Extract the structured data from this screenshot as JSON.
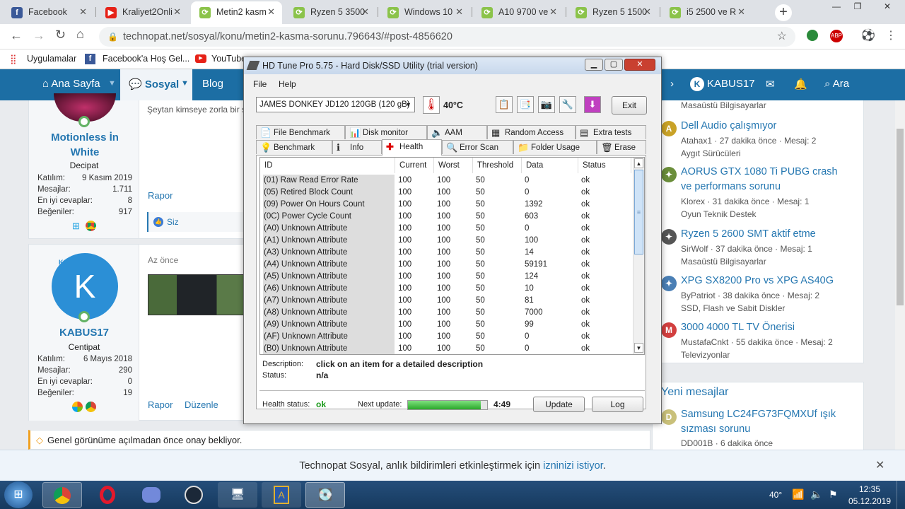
{
  "browser": {
    "tabs": [
      {
        "label": "Facebook",
        "color": "#3b5998",
        "glyph": "f"
      },
      {
        "label": "Kraliyet2Onli",
        "color": "#e62117",
        "glyph": "▶"
      },
      {
        "label": "Metin2 kasm",
        "color": "#8bc34a",
        "glyph": "⟳"
      },
      {
        "label": "Ryzen 5 3500",
        "color": "#8bc34a",
        "glyph": "⟳"
      },
      {
        "label": "Windows 10",
        "color": "#8bc34a",
        "glyph": "⟳"
      },
      {
        "label": "A10 9700 ve",
        "color": "#8bc34a",
        "glyph": "⟳"
      },
      {
        "label": "Ryzen 5 1500",
        "color": "#8bc34a",
        "glyph": "⟳"
      },
      {
        "label": "i5 2500 ve R",
        "color": "#8bc34a",
        "glyph": "⟳"
      }
    ],
    "url": "technopat.net/sosyal/konu/metin2-kasma-sorunu.796643/#post-4856620",
    "bookmarks": [
      "Uygulamalar",
      "Facebook'a Hoş Gel...",
      "YouTube"
    ]
  },
  "nav": {
    "home": "Ana Sayfa",
    "social": "Sosyal",
    "blog": "Blog",
    "user": "KABUS17",
    "search": "Ara"
  },
  "post1": {
    "username": "Motionless İn White",
    "rank": "Decipat",
    "text": "Şeytan kimseye zorla bir ş",
    "report": "Rapor",
    "like": "Siz",
    "stats": [
      {
        "label": "Katılım:",
        "value": "9 Kasım 2019"
      },
      {
        "label": "Mesajlar:",
        "value": "1.711"
      },
      {
        "label": "En iyi cevaplar:",
        "value": "8"
      },
      {
        "label": "Beğeniler:",
        "value": "917"
      }
    ]
  },
  "post2": {
    "avatar_letter": "K",
    "badge": "KS",
    "username": "KABUS17",
    "rank": "Centipat",
    "time": "Az önce",
    "report": "Rapor",
    "edit": "Düzenle",
    "stats": [
      {
        "label": "Katılım:",
        "value": "6 Mayıs 2018"
      },
      {
        "label": "Mesajlar:",
        "value": "290"
      },
      {
        "label": "En iyi cevaplar:",
        "value": "0"
      },
      {
        "label": "Beğeniler:",
        "value": "19"
      }
    ]
  },
  "pending": "Genel görünüme açılmadan önce onay bekliyor.",
  "sidebar": {
    "top_meta": "Masaüstü Bilgisayarlar",
    "items": [
      {
        "avatar": "A",
        "color": "#c9a227",
        "title": "Dell Audio çalışmıyor",
        "meta": "Atahax1 · 27 dakika önce · Mesaj: 2",
        "forum": "Aygıt Sürücüleri"
      },
      {
        "avatar": "✦",
        "color": "#6b8e3a",
        "title": "AORUS GTX 1080 Ti PUBG crash ve performans sorunu",
        "meta": "Klorex · 31 dakika önce · Mesaj: 1",
        "forum": "Oyun Teknik Destek"
      },
      {
        "avatar": "✦",
        "color": "#555555",
        "title": "Ryzen 5 2600 SMT aktif etme",
        "meta": "SirWolf · 37 dakika önce · Mesaj: 1",
        "forum": "Masaüstü Bilgisayarlar"
      },
      {
        "avatar": "✦",
        "color": "#4a7fb5",
        "title": "XPG SX8200 Pro vs XPG AS40G",
        "meta": "ByPatriot · 38 dakika önce · Mesaj: 2",
        "forum": "SSD, Flash ve Sabit Diskler"
      },
      {
        "avatar": "M",
        "color": "#d23f3f",
        "title": "3000 4000 TL TV Önerisi",
        "meta": "MustafaCnkt · 55 dakika önce · Mesaj: 2",
        "forum": "Televizyonlar"
      }
    ],
    "new_heading": "Yeni mesajlar",
    "new_item": {
      "avatar": "D",
      "color": "#c9c07a",
      "title": "Samsung LC24FG73FQMXUf ışık sızması sorunu",
      "meta": "DD001B · 6 dakika önce"
    }
  },
  "notification": {
    "text": "Technopat Sosyal, anlık bildirimleri etkinleştirmek için ",
    "link": "izninizi istiyor",
    "end": "."
  },
  "hdtune": {
    "title": "HD Tune Pro 5.75 - Hard Disk/SSD Utility (trial version)",
    "menu": [
      "File",
      "Help"
    ],
    "drive": "JAMES DONKEY JD120 120GB (120 gB)",
    "temp": "40°C",
    "exit": "Exit",
    "tabs_row1": [
      "File Benchmark",
      "Disk monitor",
      "AAM",
      "Random Access",
      "Extra tests"
    ],
    "tabs_row2": [
      "Benchmark",
      "Info",
      "Health",
      "Error Scan",
      "Folder Usage",
      "Erase"
    ],
    "columns": [
      "ID",
      "Current",
      "Worst",
      "Threshold",
      "Data",
      "Status"
    ],
    "rows": [
      [
        "(01) Raw Read Error Rate",
        "100",
        "100",
        "50",
        "0",
        "ok"
      ],
      [
        "(05) Retired Block Count",
        "100",
        "100",
        "50",
        "0",
        "ok"
      ],
      [
        "(09) Power On Hours Count",
        "100",
        "100",
        "50",
        "1392",
        "ok"
      ],
      [
        "(0C) Power Cycle Count",
        "100",
        "100",
        "50",
        "603",
        "ok"
      ],
      [
        "(A0) Unknown Attribute",
        "100",
        "100",
        "50",
        "0",
        "ok"
      ],
      [
        "(A1) Unknown Attribute",
        "100",
        "100",
        "50",
        "100",
        "ok"
      ],
      [
        "(A3) Unknown Attribute",
        "100",
        "100",
        "50",
        "14",
        "ok"
      ],
      [
        "(A4) Unknown Attribute",
        "100",
        "100",
        "50",
        "59191",
        "ok"
      ],
      [
        "(A5) Unknown Attribute",
        "100",
        "100",
        "50",
        "124",
        "ok"
      ],
      [
        "(A6) Unknown Attribute",
        "100",
        "100",
        "50",
        "10",
        "ok"
      ],
      [
        "(A7) Unknown Attribute",
        "100",
        "100",
        "50",
        "81",
        "ok"
      ],
      [
        "(A8) Unknown Attribute",
        "100",
        "100",
        "50",
        "7000",
        "ok"
      ],
      [
        "(A9) Unknown Attribute",
        "100",
        "100",
        "50",
        "99",
        "ok"
      ],
      [
        "(AF) Unknown Attribute",
        "100",
        "100",
        "50",
        "0",
        "ok"
      ],
      [
        "(B0) Unknown Attribute",
        "100",
        "100",
        "50",
        "0",
        "ok"
      ]
    ],
    "desc_label": "Description:",
    "desc_value": "click on an item for a detailed description",
    "status_label": "Status:",
    "status_value": "n/a",
    "health_label": "Health status:",
    "health_value": "ok",
    "next_label": "Next update:",
    "next_progress": 0.92,
    "next_time": "4:49",
    "update": "Update",
    "log": "Log"
  },
  "tray": {
    "temp": "40°",
    "time": "12:35",
    "date": "05.12.2019"
  }
}
